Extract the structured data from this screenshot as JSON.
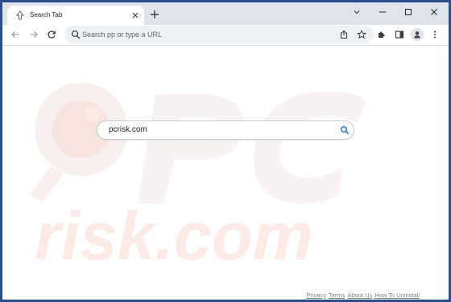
{
  "tab": {
    "title": "Search Tab",
    "favicon": "up-arrow-icon"
  },
  "window_controls": {
    "tab_list": "chevron-down-icon",
    "minimize": "minimize-icon",
    "maximize": "maximize-icon",
    "close": "close-icon"
  },
  "toolbar": {
    "omnibox_placeholder": "Search pp or type a URL"
  },
  "search": {
    "value": "pcrisk.com"
  },
  "footer": {
    "links": [
      "Privacy",
      "Terms",
      "About Us",
      "How To Uninstall"
    ]
  },
  "watermark": {
    "text": "risk.com"
  },
  "colors": {
    "frame": "#2b4d8c",
    "tabstrip": "#dfe3eb",
    "omnibox": "#eef1f6",
    "search_accent": "#1a73e8",
    "watermark": "#f6d9cc"
  }
}
